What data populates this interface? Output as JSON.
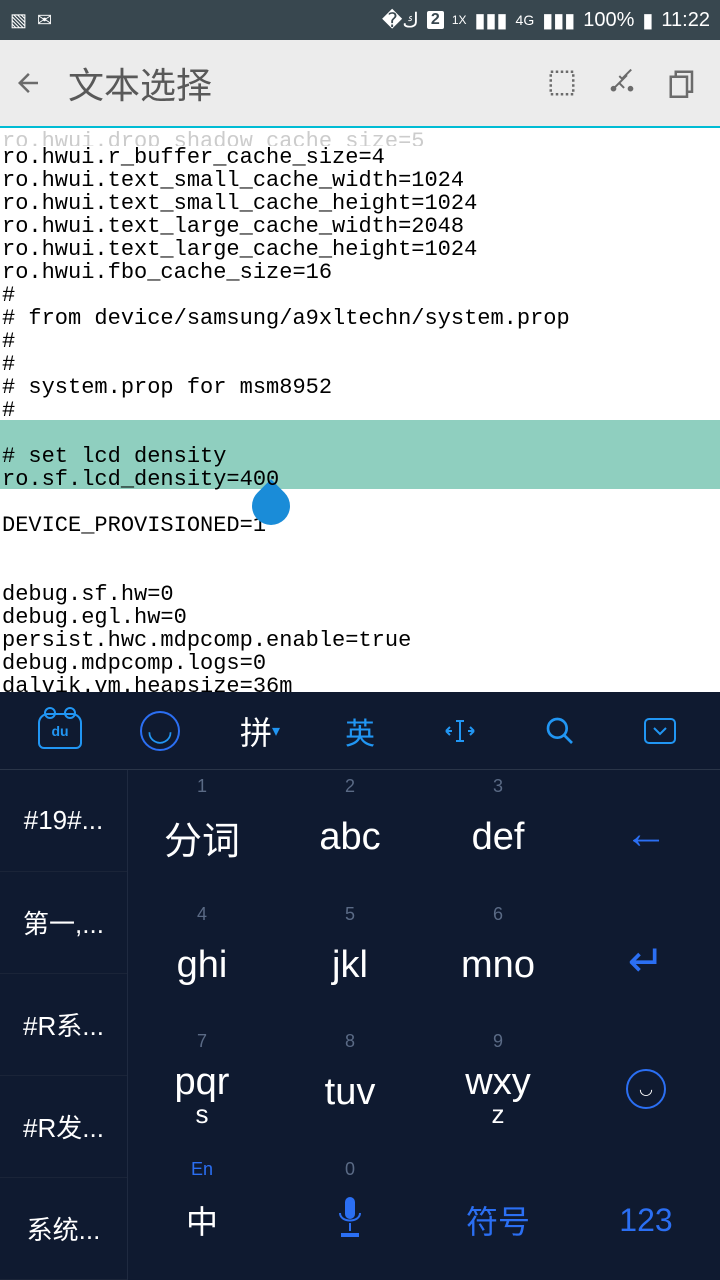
{
  "status": {
    "time": "11:22",
    "battery": "100%",
    "network1": "4G",
    "network2": "1X",
    "sim": "2"
  },
  "appbar": {
    "title": "文本选择"
  },
  "editor": {
    "lines": [
      "ro.hwui.drop_shadow_cache_size=5",
      "ro.hwui.r_buffer_cache_size=4",
      "ro.hwui.text_small_cache_width=1024",
      "ro.hwui.text_small_cache_height=1024",
      "ro.hwui.text_large_cache_width=2048",
      "ro.hwui.text_large_cache_height=1024",
      "ro.hwui.fbo_cache_size=16",
      "#",
      "# from device/samsung/a9xltechn/system.prop",
      "#",
      "#",
      "# system.prop for msm8952",
      "#",
      "",
      "# set lcd density",
      "ro.sf.lcd_density=400",
      "",
      "DEVICE_PROVISIONED=1",
      "",
      "",
      "debug.sf.hw=0",
      "debug.egl.hw=0",
      "persist.hwc.mdpcomp.enable=true",
      "debug.mdpcomp.logs=0",
      "dalvik.vm.heapsize=36m"
    ],
    "selStart": 13,
    "selEnd": 15
  },
  "keyboard": {
    "top": [
      "du",
      "☺",
      "拼",
      "英",
      "〈I〉",
      "⌕",
      "⌄"
    ],
    "side": [
      "#19#...",
      "第一,...",
      "#R系...",
      "#R发...",
      "系统..."
    ],
    "keys": [
      [
        {
          "n": "1",
          "m": "分词"
        },
        {
          "n": "2",
          "m": "abc"
        },
        {
          "n": "3",
          "m": "def"
        },
        {
          "action": "←"
        }
      ],
      [
        {
          "n": "4",
          "m": "ghi"
        },
        {
          "n": "5",
          "m": "jkl"
        },
        {
          "n": "6",
          "m": "mno"
        },
        {
          "action": "↵"
        }
      ],
      [
        {
          "n": "7",
          "m": "pqr",
          "s": "s"
        },
        {
          "n": "8",
          "m": "tuv"
        },
        {
          "n": "9",
          "m": "wxy",
          "s": "z"
        },
        {
          "emoji": true
        }
      ],
      [
        {
          "t": "En",
          "m": "中"
        },
        {
          "n": "0",
          "mic": true
        },
        {
          "m": "符号",
          "blue": true
        },
        {
          "m": "123",
          "blue": true
        }
      ]
    ]
  }
}
